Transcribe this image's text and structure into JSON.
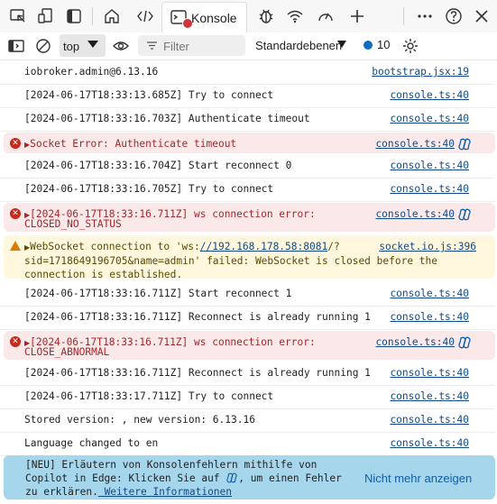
{
  "tabs": {
    "active_label": "Konsole"
  },
  "toolbar": {
    "context": "top",
    "filter_placeholder": "Filter",
    "levels": "Standardebenen",
    "issues_count": "10"
  },
  "rows": [
    {
      "msg": "iobroker.admin@6.13.16",
      "src": "bootstrap.jsx:19"
    },
    {
      "msg": "[2024-06-17T18:33:13.685Z] Try to connect",
      "src": "console.ts:40"
    },
    {
      "msg": "[2024-06-17T18:33:16.703Z] Authenticate timeout",
      "src": "console.ts:40"
    },
    {
      "msg": "Socket Error: Authenticate timeout",
      "src": "console.ts:40"
    },
    {
      "msg": "[2024-06-17T18:33:16.704Z] Start reconnect 0",
      "src": "console.ts:40"
    },
    {
      "msg": "[2024-06-17T18:33:16.705Z] Try to connect",
      "src": "console.ts:40"
    },
    {
      "msg1": "[2024-06-17T18:33:16.711Z] ws connection error:",
      "msg2": "CLOSED_NO_STATUS",
      "src": "console.ts:40"
    },
    {
      "msg_prefix": "WebSocket connection to 'ws:",
      "msg_link": "//192.168.178.58:8081",
      "msg_suffix": "/?",
      "msg2": "sid=1718649196705&name=admin' failed: WebSocket is closed before the",
      "msg3": "connection is established.",
      "src": "socket.io.js:396"
    },
    {
      "msg": "[2024-06-17T18:33:16.711Z] Start reconnect 1",
      "src": "console.ts:40"
    },
    {
      "msg": "[2024-06-17T18:33:16.711Z] Reconnect is already running 1",
      "src": "console.ts:40"
    },
    {
      "msg1": "[2024-06-17T18:33:16.711Z] ws connection error:",
      "msg2": "CLOSE_ABNORMAL",
      "src": "console.ts:40"
    },
    {
      "msg": "[2024-06-17T18:33:16.711Z] Reconnect is already running 1",
      "src": "console.ts:40"
    },
    {
      "msg": "[2024-06-17T18:33:17.711Z] Try to connect",
      "src": "console.ts:40"
    },
    {
      "msg": "Stored version: , new version: 6.13.16",
      "src": "console.ts:40"
    },
    {
      "msg": "Language changed to en",
      "src": "console.ts:40"
    }
  ],
  "banner": {
    "line1": "[NEU] Erläutern von Konsolenfehlern mithilfe von",
    "line2a": "Copilot in Edge: Klicken Sie auf",
    "line2b": ", um einen Fehler",
    "line3a": "zu erklären.",
    "link": " Weitere Informationen",
    "dismiss": "Nicht mehr anzeigen"
  },
  "colors": {
    "error_bg": "#fbe9e9",
    "warning_bg": "#fff8df",
    "banner_bg": "#a6d6ec",
    "link": "#0f4a85"
  }
}
